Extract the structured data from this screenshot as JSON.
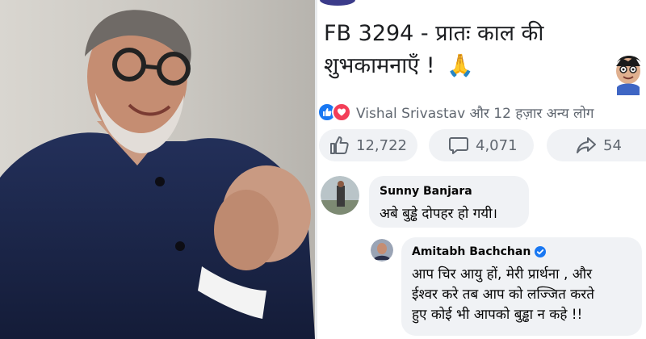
{
  "post": {
    "title_line1": "FB 3294 - प्रातः काल की",
    "title_line2": "शुभकामनाएँ  !",
    "title_emoji": "🙏",
    "reactions_text": "Vishal Srivastav और 12 हज़ार अन्य लोग",
    "likes": "12,722",
    "comments": "4,071",
    "shares": "54"
  },
  "comments": [
    {
      "author": "Sunny Banjara",
      "text": "अबे बुड्ढे  दोपहर हो गयी।"
    },
    {
      "author": "Amitabh Bachchan",
      "verified": true,
      "lines": [
        "आप  चिर आयु हों, मेरी प्रार्थना  , और",
        "ईश्वर करे तब आप को लज्जित करते",
        "हुए कोई भी आपको बुड्ढा न कहे  !!"
      ]
    }
  ],
  "colors": {
    "fb_blue": "#1877f2",
    "love_red": "#f33e58",
    "bubble_bg": "#f0f2f5",
    "muted_text": "#606770"
  }
}
